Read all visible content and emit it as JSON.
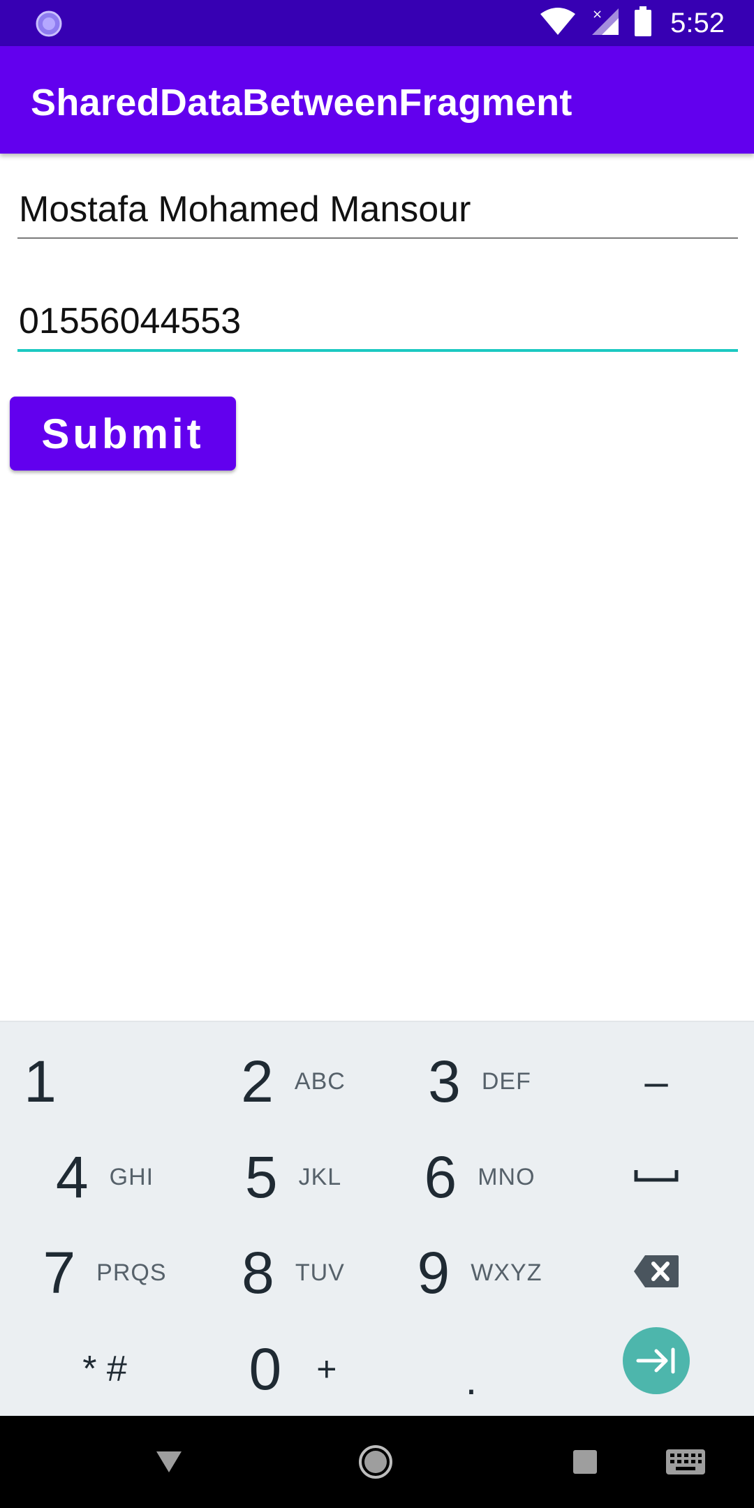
{
  "status_bar": {
    "time": "5:52",
    "icons": [
      "app-notification-icon",
      "wifi-icon",
      "signal-icon",
      "battery-icon"
    ]
  },
  "app_bar": {
    "title": "SharedDataBetweenFragment"
  },
  "form": {
    "name_value": "Mostafa Mohamed Mansour",
    "phone_value": "01556044553",
    "submit_label": "Submit"
  },
  "keyboard": {
    "rows": [
      [
        {
          "digit": "1",
          "letters": ""
        },
        {
          "digit": "2",
          "letters": "ABC"
        },
        {
          "digit": "3",
          "letters": "DEF"
        },
        {
          "sym": "–"
        }
      ],
      [
        {
          "digit": "4",
          "letters": "GHI"
        },
        {
          "digit": "5",
          "letters": "JKL"
        },
        {
          "digit": "6",
          "letters": "MNO"
        },
        {
          "sym": "space-icon"
        }
      ],
      [
        {
          "digit": "7",
          "letters": "PRQS"
        },
        {
          "digit": "8",
          "letters": "TUV"
        },
        {
          "digit": "9",
          "letters": "WXYZ"
        },
        {
          "sym": "backspace-icon"
        }
      ],
      [
        {
          "sym": "* #"
        },
        {
          "digit": "0",
          "letters": "+"
        },
        {
          "sym": "."
        },
        {
          "sym": "next-icon"
        }
      ]
    ],
    "key_1": "1",
    "key_2": "2",
    "key_2_letters": "ABC",
    "key_3": "3",
    "key_3_letters": "DEF",
    "key_dash": "–",
    "key_4": "4",
    "key_4_letters": "GHI",
    "key_5": "5",
    "key_5_letters": "JKL",
    "key_6": "6",
    "key_6_letters": "MNO",
    "key_7": "7",
    "key_7_letters": "PRQS",
    "key_8": "8",
    "key_8_letters": "TUV",
    "key_9": "9",
    "key_9_letters": "WXYZ",
    "key_star_hash": "* #",
    "key_0": "0",
    "key_plus": "+",
    "key_dot": "."
  },
  "colors": {
    "status_bar": "#3700B3",
    "primary": "#6200EE",
    "accent": "#1CC9C1",
    "keyboard_bg": "#EBEFF2",
    "enter_key": "#4DB6AC"
  },
  "nav_bar": {
    "icons": [
      "back-icon",
      "home-icon",
      "recents-icon",
      "keyboard-switch-icon"
    ]
  }
}
